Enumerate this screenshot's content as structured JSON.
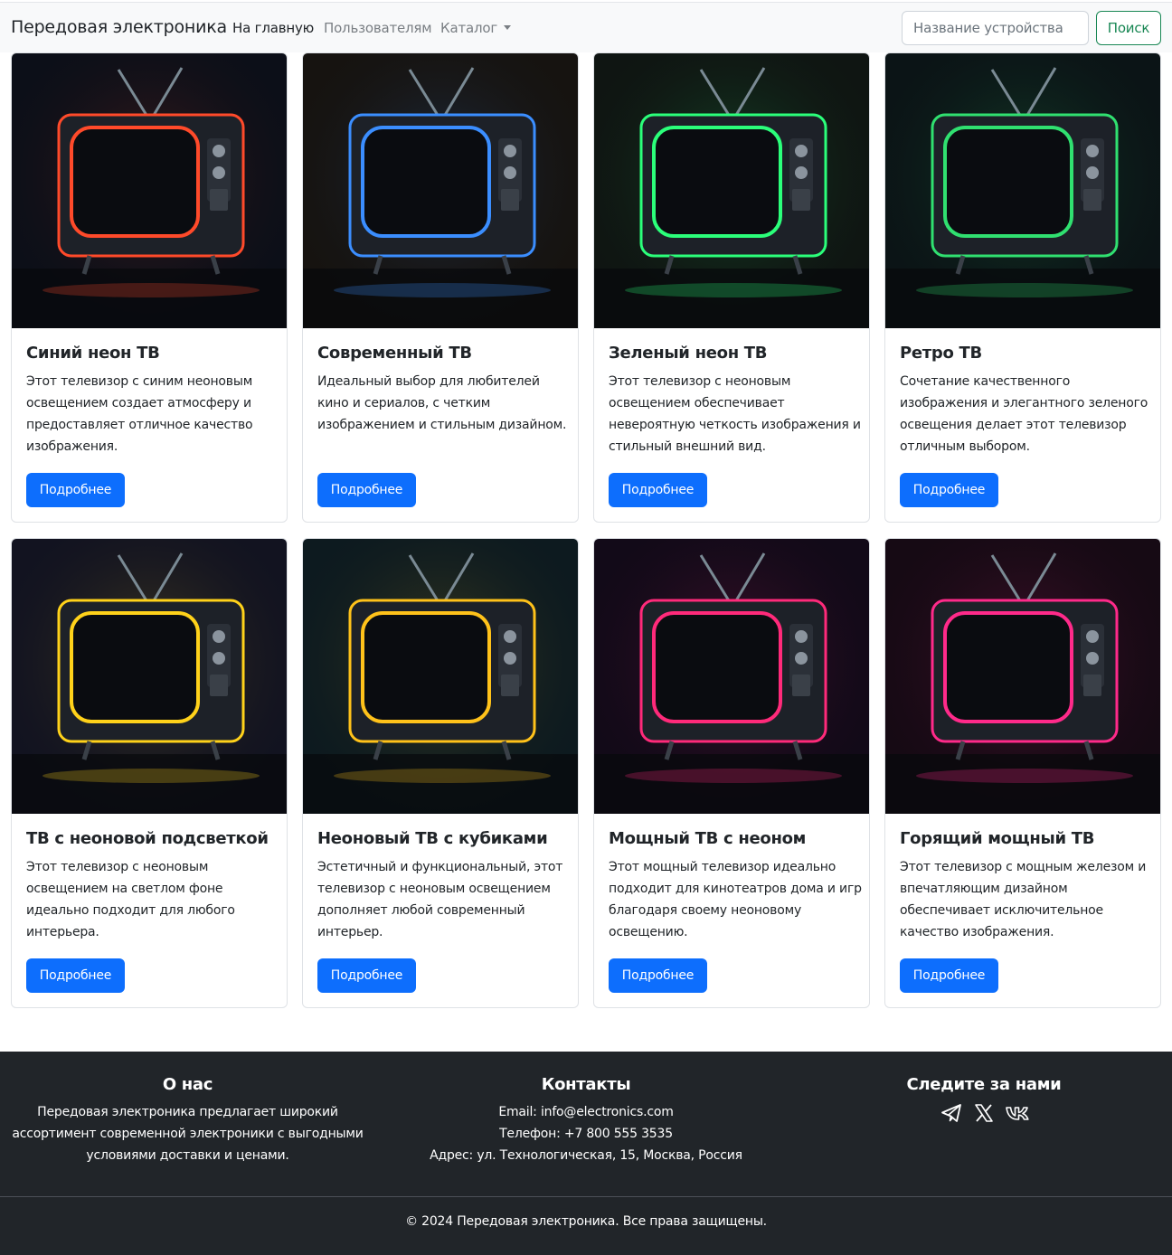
{
  "navbar": {
    "brand": "Передовая электроника",
    "links": [
      "На главную",
      "Пользователям",
      "Каталог"
    ],
    "search_placeholder": "Название устройства",
    "search_button": "Поиск"
  },
  "products": [
    {
      "title": "Синий неон ТВ",
      "text": "Этот телевизор с синим неоновым освещением создает атмосферу и предоставляет отличное качество изображения.",
      "button": "Подробнее",
      "glow": "#ff4a2a"
    },
    {
      "title": "Современный ТВ",
      "text": "Идеальный выбор для любителей кино и сериалов, с четким изображением и стильным дизайном.",
      "button": "Подробнее",
      "glow": "#3b8eff"
    },
    {
      "title": "Зеленый неон ТВ",
      "text": "Этот телевизор с неоновым освещением обеспечивает невероятную четкость изображения и стильный внешний вид.",
      "button": "Подробнее",
      "glow": "#2bff7a"
    },
    {
      "title": "Ретро ТВ",
      "text": "Сочетание качественного изображения и элегантного зеленого освещения делает этот телевизор отличным выбором.",
      "button": "Подробнее",
      "glow": "#30e070"
    },
    {
      "title": "ТВ с неоновой подсветкой",
      "text": "Этот телевизор с неоновым освещением на светлом фоне идеально подходит для любого интерьера.",
      "button": "Подробнее",
      "glow": "#ffd21a"
    },
    {
      "title": "Неоновый ТВ с кубиками",
      "text": "Эстетичный и функциональный, этот телевизор с неоновым освещением дополняет любой современный интерьер.",
      "button": "Подробнее",
      "glow": "#ffc21a"
    },
    {
      "title": "Мощный ТВ с неоном",
      "text": "Этот мощный телевизор идеально подходит для кинотеатров дома и игр благодаря своему неоновому освещению.",
      "button": "Подробнее",
      "glow": "#ff2a7a"
    },
    {
      "title": "Горящий мощный ТВ",
      "text": "Этот телевизор с мощным железом и впечатляющим дизайном обеспечивает исключительное качество изображения.",
      "button": "Подробнее",
      "glow": "#ff2a8a"
    }
  ],
  "footer": {
    "about_title": "О нас",
    "about_text": "Передовая электроника предлагает широкий ассортимент современной электроники с выгодными условиями доставки и ценами.",
    "contacts_title": "Контакты",
    "email": "Email: info@electronics.com",
    "phone": "Телефон: +7 800 555 3535",
    "address": "Адрес: ул. Технологическая, 15, Москва, Россия",
    "follow_title": "Следите за нами",
    "social_icons": [
      "telegram-icon",
      "x-icon",
      "vk-icon"
    ],
    "copyright": "© 2024 Передовая электроника. Все права защищены."
  },
  "colors": {
    "primary": "#0d6efd",
    "success": "#198754",
    "footer_bg": "#212529",
    "navbar_bg": "#f8f9fa"
  }
}
